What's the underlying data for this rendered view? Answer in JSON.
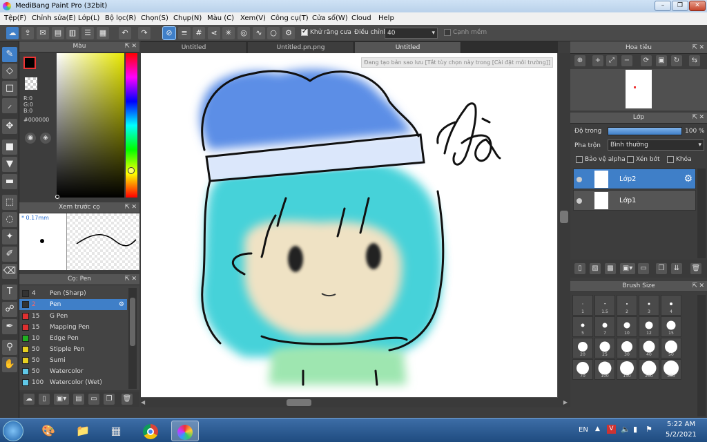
{
  "window": {
    "title": "MediBang Paint Pro (32bit)"
  },
  "menu": [
    "Tệp(F)",
    "Chỉnh sửa(E)",
    "Lớp(L)",
    "Bộ lọc(R)",
    "Chọn(S)",
    "Chụp(N)",
    "Màu (C)",
    "Xem(V)",
    "Công cụ(T)",
    "Cửa sổ(W)",
    "Cloud",
    "Help"
  ],
  "toolbar": {
    "antialias_label": "Khử răng cưa",
    "antialias_checked": true,
    "adjust_label": "Điều chỉnh",
    "adjust_value": "40",
    "edge_label": "Cạnh mềm"
  },
  "tabs": [
    "Untitled",
    "Untitled.pn.png",
    "Untitled"
  ],
  "canvas": {
    "notice": "Đang tạo bản sao lưu [Tắt tùy chọn này trong [Cài đặt môi trường]]",
    "signature": "Hà"
  },
  "color_panel": {
    "title": "Màu",
    "r": "R:0",
    "g": "G:0",
    "b": "B:0",
    "hex": "#000000"
  },
  "brush_preview": {
    "title": "Xem trước cọ",
    "size": "0.17mm"
  },
  "brush_panel": {
    "title": "Cọ: Pen",
    "brushes": [
      {
        "size": "4",
        "name": "Pen (Sharp)",
        "color": "#333333"
      },
      {
        "size": "2",
        "name": "Pen",
        "color": "#333333",
        "selected": true
      },
      {
        "size": "15",
        "name": "G Pen",
        "color": "#e03030"
      },
      {
        "size": "15",
        "name": "Mapping Pen",
        "color": "#e03030"
      },
      {
        "size": "10",
        "name": "Edge Pen",
        "color": "#20b020"
      },
      {
        "size": "50",
        "name": "Stipple Pen",
        "color": "#e8d020"
      },
      {
        "size": "50",
        "name": "Sumi",
        "color": "#e8d020"
      },
      {
        "size": "50",
        "name": "Watercolor",
        "color": "#60c8e8"
      },
      {
        "size": "100",
        "name": "Watercolor (Wet)",
        "color": "#60c8e8"
      }
    ]
  },
  "navigator": {
    "title": "Hoa tiêu"
  },
  "layer_panel": {
    "title": "Lớp",
    "opacity_label": "Độ trong",
    "opacity_value": "100 %",
    "opacity": 1.0,
    "blend_label": "Pha trộn",
    "blend_value": "Bình thường",
    "protect_alpha": "Bảo vệ alpha",
    "clipping": "Xén bớt",
    "lock": "Khóa",
    "layers": [
      "Lớp2",
      "Lớp1"
    ]
  },
  "brush_size_panel": {
    "title": "Brush Size",
    "sizes": [
      "1",
      "1.5",
      "2",
      "3",
      "4",
      "5",
      "7",
      "10",
      "12",
      "15",
      "20",
      "25",
      "30",
      "40",
      "50",
      "70",
      "100",
      "150",
      "200",
      "300"
    ]
  },
  "taskbar": {
    "lang": "EN",
    "time": "5:22 AM",
    "date": "5/2/2021"
  },
  "colors": {
    "accent": "#3f7fc8",
    "panel": "#3d3d3d",
    "hat": "#5b8ee6",
    "hair": "#3ed0d8",
    "skin": "#efe2c4"
  }
}
